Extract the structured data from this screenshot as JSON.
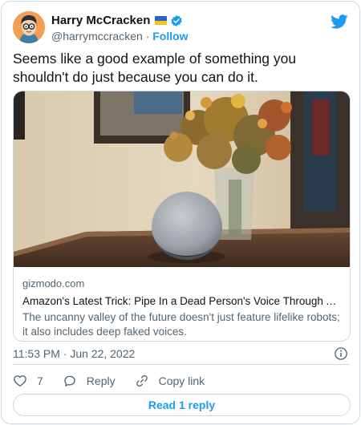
{
  "author": {
    "display_name": "Harry McCracken",
    "handle": "@harrymccracken",
    "separator": "·",
    "follow_label": "Follow"
  },
  "tweet": {
    "text": "Seems like a good example of something you shouldn't do just because you can do it."
  },
  "link_card": {
    "domain": "gizmodo.com",
    "title": "Amazon's Latest Trick: Pipe In a Dead Person's Voice Through Alexa'...",
    "description": "The uncanny valley of the future doesn't just feature lifelike robots; it also includes deep faked voices."
  },
  "timestamp": "11:53 PM · Jun 22, 2022",
  "actions": {
    "like_count": "7",
    "reply_label": "Reply",
    "copy_link_label": "Copy link"
  },
  "read_replies_label": "Read 1 reply",
  "colors": {
    "accent": "#1d9bf0",
    "secondary_text": "#536471",
    "border": "#cfd9de",
    "flag_blue": "#2a62c7",
    "flag_yellow": "#f5c518"
  },
  "icons": [
    "avatar",
    "ukraine-flag-icon",
    "verified-badge-icon",
    "twitter-bird-icon",
    "info-icon",
    "heart-icon",
    "reply-bubble-icon",
    "link-icon"
  ]
}
